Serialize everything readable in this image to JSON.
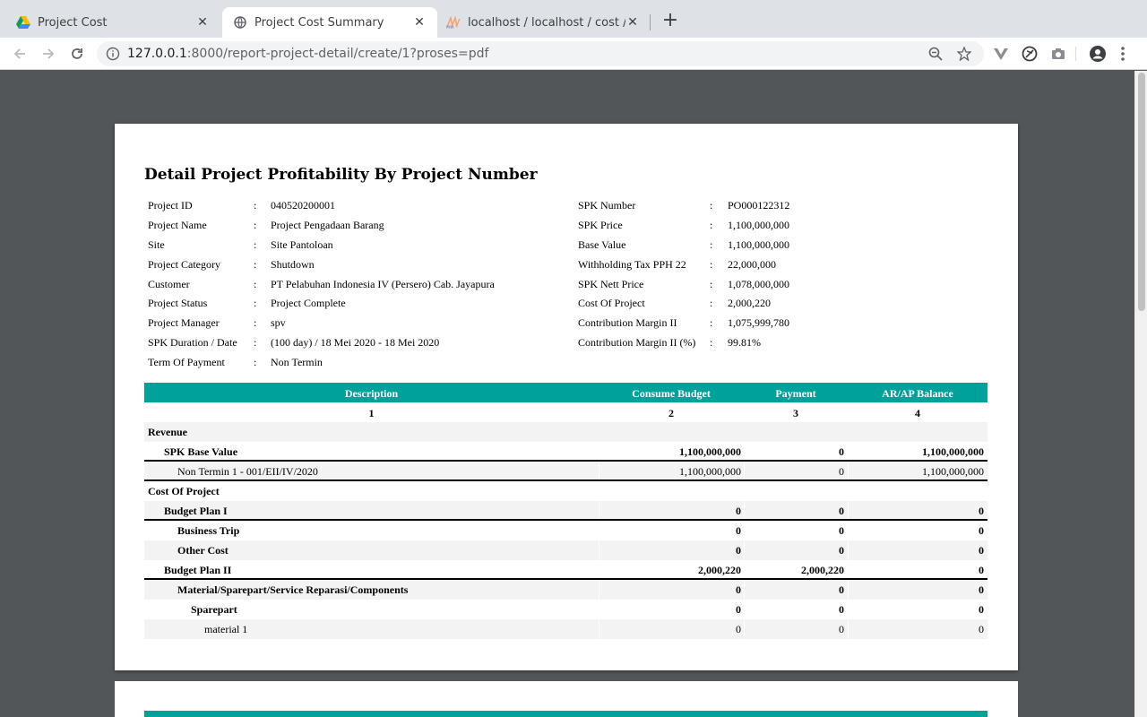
{
  "browser": {
    "tabs": [
      {
        "title": "Project Cost",
        "close": "✕"
      },
      {
        "title": "Project Cost Summary",
        "close": "✕"
      },
      {
        "title": "localhost / localhost / cost / tra",
        "close": "✕"
      }
    ],
    "new_tab": "+",
    "address": {
      "host": "127.0.0.1",
      "path": ":8000/report-project-detail/create/1?proses=pdf"
    }
  },
  "report": {
    "title": "Detail Project Profitability By Project Number",
    "left_fields": [
      {
        "label": "Project ID",
        "value": "040520200001"
      },
      {
        "label": "Project Name",
        "value": "Project Pengadaan Barang"
      },
      {
        "label": "Site",
        "value": "Site Pantoloan"
      },
      {
        "label": "Project Category",
        "value": "Shutdown"
      },
      {
        "label": "Customer",
        "value": "PT Pelabuhan Indonesia IV (Persero) Cab. Jayapura"
      },
      {
        "label": "Project Status",
        "value": "Project Complete"
      },
      {
        "label": "Project Manager",
        "value": "spv"
      },
      {
        "label": "SPK Duration / Date",
        "value": "(100 day) / 18 Mei 2020 - 18 Mei 2020"
      },
      {
        "label": "Term Of Payment",
        "value": "Non Termin"
      }
    ],
    "right_fields": [
      {
        "label": "SPK Number",
        "value": "PO000122312"
      },
      {
        "label": "SPK Price",
        "value": "1,100,000,000"
      },
      {
        "label": "Base Value",
        "value": "1,100,000,000"
      },
      {
        "label": "Withholding Tax PPH 22",
        "value": "22,000,000"
      },
      {
        "label": "SPK Nett Price",
        "value": "1,078,000,000"
      },
      {
        "label": "Cost Of Project",
        "value": "2,000,220"
      },
      {
        "label": "Contribution Margin II",
        "value": "1,075,999,780"
      },
      {
        "label": "Contribution Margin II (%)",
        "value": "99.81%"
      }
    ],
    "separator": ":",
    "table": {
      "headers": [
        "Description",
        "Consume Budget",
        "Payment",
        "AR/AP Balance"
      ],
      "column_numbers": [
        "1",
        "2",
        "3",
        "4"
      ],
      "rows": [
        {
          "desc": "Revenue",
          "budget": "",
          "payment": "",
          "balance": ""
        },
        {
          "desc": "SPK Base Value",
          "budget": "1,100,000,000",
          "payment": "0",
          "balance": "1,100,000,000"
        },
        {
          "desc": "Non Termin 1 - 001/EII/IV/2020",
          "budget": "1,100,000,000",
          "payment": "0",
          "balance": "1,100,000,000"
        },
        {
          "desc": "Cost Of Project",
          "budget": "",
          "payment": "",
          "balance": ""
        },
        {
          "desc": "Budget Plan I",
          "budget": "0",
          "payment": "0",
          "balance": "0"
        },
        {
          "desc": "Business Trip",
          "budget": "0",
          "payment": "0",
          "balance": "0"
        },
        {
          "desc": "Other Cost",
          "budget": "0",
          "payment": "0",
          "balance": "0"
        },
        {
          "desc": "Budget Plan II",
          "budget": "2,000,220",
          "payment": "2,000,220",
          "balance": "0"
        },
        {
          "desc": "Material/Sparepart/Service Reparasi/Components",
          "budget": "0",
          "payment": "0",
          "balance": "0"
        },
        {
          "desc": "Sparepart",
          "budget": "0",
          "payment": "0",
          "balance": "0"
        },
        {
          "desc": "material 1",
          "budget": "0",
          "payment": "0",
          "balance": "0"
        }
      ]
    }
  },
  "colors": {
    "accent": "#00a19a",
    "viewer_bg": "#525659",
    "tab_strip": "#dee1e6"
  }
}
